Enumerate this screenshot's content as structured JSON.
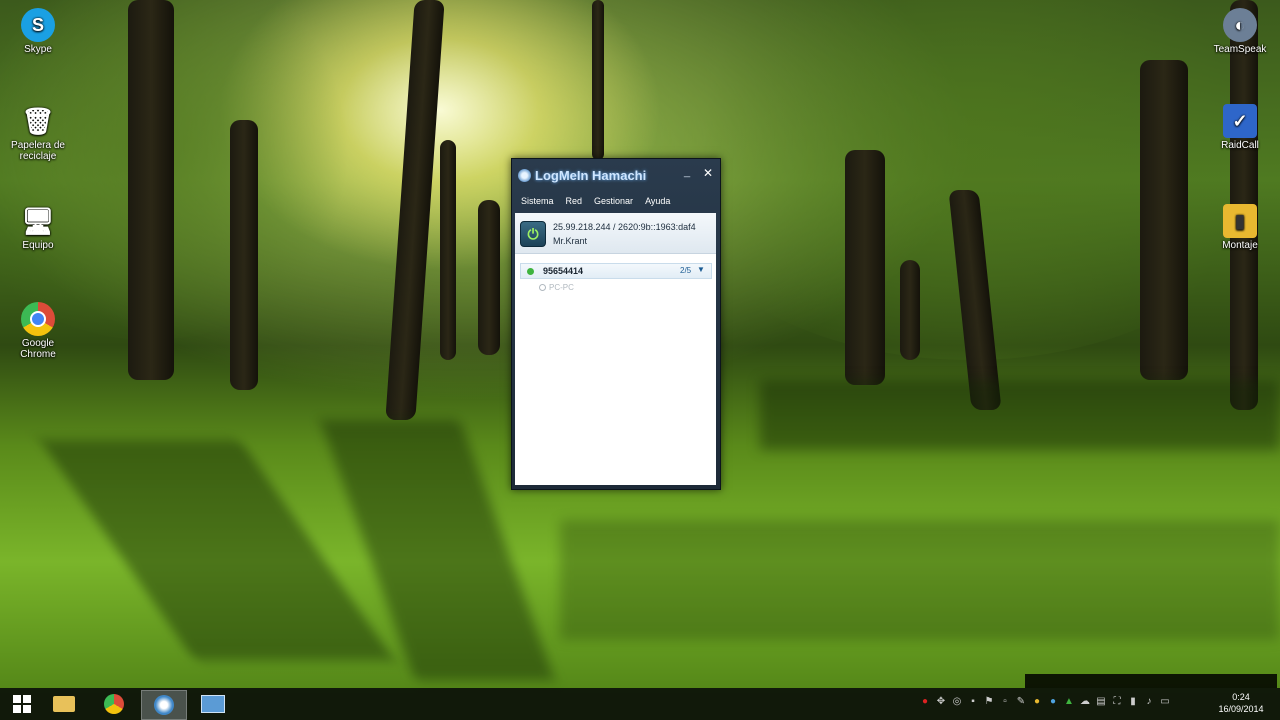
{
  "desktop": {
    "icons_left": [
      {
        "label": "Skype",
        "icon": "skype-icon",
        "color": "#1aa0e3",
        "glyph": "S"
      },
      {
        "label": "Papelera de reciclaje",
        "icon": "recycle-bin-icon",
        "color": "#9aa4ad",
        "glyph": "🗑"
      },
      {
        "label": "Equipo",
        "icon": "computer-icon",
        "color": "#2c6fd1",
        "glyph": "🖥"
      },
      {
        "label": "Google Chrome",
        "icon": "chrome-icon",
        "color": "#dd4b39",
        "glyph": "●"
      }
    ],
    "icons_right": [
      {
        "label": "TeamSpeak",
        "icon": "teamspeak-icon",
        "color": "#6c7f96",
        "glyph": "◐"
      },
      {
        "label": "RaidCall",
        "icon": "raidcall-icon",
        "color": "#2e66c9",
        "glyph": "✓"
      },
      {
        "label": "Montaje",
        "icon": "montage-icon",
        "color": "#e8b830",
        "glyph": "▮"
      }
    ]
  },
  "hamachi": {
    "title": "LogMeIn Hamachi",
    "min_label": "_",
    "close_label": "✕",
    "menu": [
      "Sistema",
      "Red",
      "Gestionar",
      "Ayuda"
    ],
    "ip": "25.99.218.244 / 2620:9b::1963:daf4",
    "nickname": "Mr.Krant",
    "power_glyph": "⏻",
    "network": {
      "id": "95654414",
      "members": "2/5",
      "arrow": "▼",
      "status_color": "#3fb43f"
    },
    "peer": "PC-PC"
  },
  "taskbar": {
    "apps": [
      "start-button",
      "file-explorer",
      "chrome",
      "hamachi",
      "remote-desktop"
    ],
    "time": "0:24",
    "date": "16/09/2014"
  }
}
